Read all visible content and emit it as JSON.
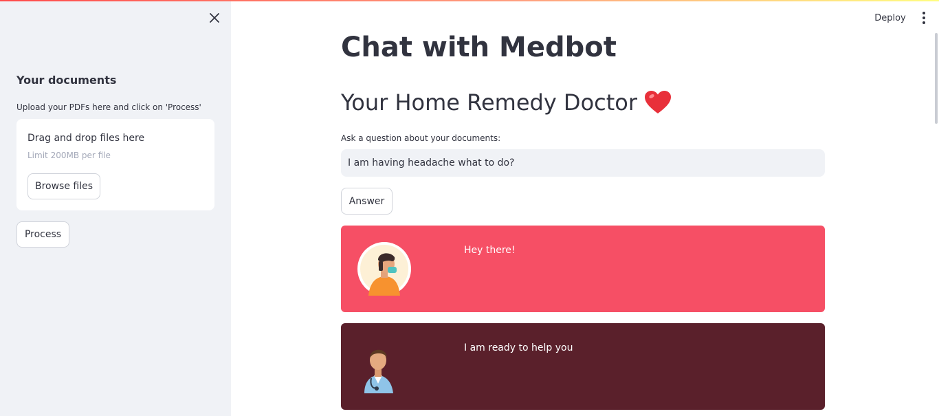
{
  "sidebar": {
    "title": "Your documents",
    "uploader_label": "Upload your PDFs here and click on 'Process'",
    "dropzone_title": "Drag and drop files here",
    "dropzone_limit": "Limit 200MB per file",
    "browse_label": "Browse files",
    "process_label": "Process"
  },
  "header": {
    "deploy_label": "Deploy"
  },
  "main": {
    "title": "Chat with Medbot",
    "subtitle": "Your Home Remedy Doctor",
    "subtitle_emoji": "heart-icon",
    "question_label": "Ask a question about your documents:",
    "question_value": "I am having headache what to do?",
    "answer_label": "Answer"
  },
  "chat": {
    "user_message": "Hey there!",
    "bot_message": "I am ready to help you"
  },
  "colors": {
    "user_bubble": "#f64f65",
    "bot_bubble": "#5a202b",
    "sidebar_bg": "#f0f2f6"
  }
}
